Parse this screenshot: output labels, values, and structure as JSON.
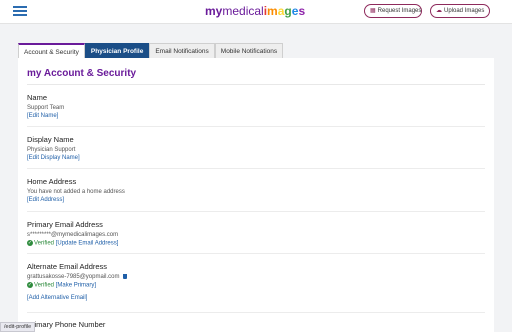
{
  "header": {
    "logo": {
      "my": "my",
      "medical": "medical",
      "images_letters": [
        "i",
        "m",
        "a",
        "g",
        "e",
        "s"
      ]
    },
    "request_label": "Request Images",
    "upload_label": "Upload Images"
  },
  "tabs": [
    {
      "label": "Account & Security"
    },
    {
      "label": "Physician Profile"
    },
    {
      "label": "Email Notifications"
    },
    {
      "label": "Mobile Notifications"
    }
  ],
  "page_title": "my Account & Security",
  "sections": {
    "name": {
      "label": "Name",
      "value": "Support Team",
      "link": "[Edit Name]"
    },
    "display_name": {
      "label": "Display Name",
      "value": "Physician Support",
      "link": "[Edit Display Name]"
    },
    "home_address": {
      "label": "Home Address",
      "value": "You have not added a home address",
      "link": "[Edit Address]"
    },
    "primary_email": {
      "label": "Primary Email Address",
      "value": "s*********@mymedicalimages.com",
      "verified": "Verified",
      "link": "[Update Email Address]"
    },
    "alternate_email": {
      "label": "Alternate Email Address",
      "value": "grattusakosse-7985@yopmail.com",
      "verified": "Verified",
      "make_primary": "[Make Primary]",
      "add_link": "[Add Alternative Email]"
    },
    "primary_phone": {
      "label": "Primary Phone Number"
    }
  },
  "status_url": "/edit-profile",
  "colors": {
    "brand_purple": "#6a1b9a",
    "tab_active": "#1b4e87",
    "link": "#1f5fa8",
    "verified": "#2e8b3d"
  }
}
